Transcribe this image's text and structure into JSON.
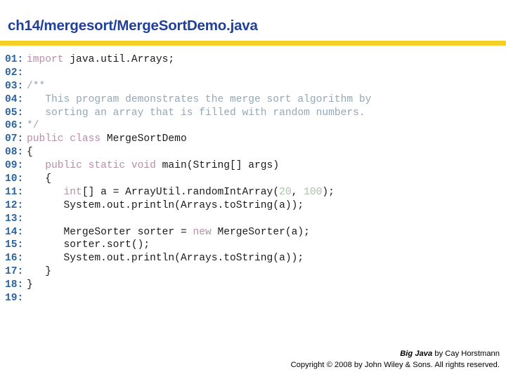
{
  "header": {
    "title": "ch14/mergesort/MergeSortDemo.java",
    "title_color": "#21409a",
    "rule_color": "#f6cf26"
  },
  "code": {
    "language": "java",
    "colors": {
      "lineno": "#2a64a0",
      "keyword": "#b98ca8",
      "comment": "#93a7b5",
      "number": "#a8c4a4",
      "plain": "#1a1a1a"
    },
    "lines": [
      {
        "n": "01:",
        "tokens": [
          {
            "t": "import",
            "c": "kw"
          },
          {
            "t": " java.util.Arrays;",
            "c": "pl"
          }
        ]
      },
      {
        "n": "02:",
        "tokens": []
      },
      {
        "n": "03:",
        "tokens": [
          {
            "t": "/**",
            "c": "cm"
          }
        ]
      },
      {
        "n": "04:",
        "tokens": [
          {
            "t": "   This program demonstrates the merge sort algorithm by",
            "c": "cm"
          }
        ]
      },
      {
        "n": "05:",
        "tokens": [
          {
            "t": "   sorting an array that is filled with random numbers.",
            "c": "cm"
          }
        ]
      },
      {
        "n": "06:",
        "tokens": [
          {
            "t": "*/",
            "c": "cm"
          }
        ]
      },
      {
        "n": "07:",
        "tokens": [
          {
            "t": "public class",
            "c": "kw"
          },
          {
            "t": " MergeSortDemo",
            "c": "pl"
          }
        ]
      },
      {
        "n": "08:",
        "tokens": [
          {
            "t": "{",
            "c": "pl"
          }
        ]
      },
      {
        "n": "09:",
        "tokens": [
          {
            "t": "   ",
            "c": "pl"
          },
          {
            "t": "public static void",
            "c": "kw"
          },
          {
            "t": " main(String[] args)",
            "c": "pl"
          }
        ]
      },
      {
        "n": "10:",
        "tokens": [
          {
            "t": "   {",
            "c": "pl"
          }
        ]
      },
      {
        "n": "11:",
        "tokens": [
          {
            "t": "      ",
            "c": "pl"
          },
          {
            "t": "int",
            "c": "kw"
          },
          {
            "t": "[] a = ArrayUtil.randomIntArray(",
            "c": "pl"
          },
          {
            "t": "20",
            "c": "num"
          },
          {
            "t": ", ",
            "c": "pl"
          },
          {
            "t": "100",
            "c": "num"
          },
          {
            "t": ");",
            "c": "pl"
          }
        ]
      },
      {
        "n": "12:",
        "tokens": [
          {
            "t": "      System.out.println(Arrays.toString(a));",
            "c": "pl"
          }
        ]
      },
      {
        "n": "13:",
        "tokens": []
      },
      {
        "n": "14:",
        "tokens": [
          {
            "t": "      MergeSorter sorter = ",
            "c": "pl"
          },
          {
            "t": "new",
            "c": "kw"
          },
          {
            "t": " MergeSorter(a);",
            "c": "pl"
          }
        ]
      },
      {
        "n": "15:",
        "tokens": [
          {
            "t": "      sorter.sort();",
            "c": "pl"
          }
        ]
      },
      {
        "n": "16:",
        "tokens": [
          {
            "t": "      System.out.println(Arrays.toString(a));",
            "c": "pl"
          }
        ]
      },
      {
        "n": "17:",
        "tokens": [
          {
            "t": "   }",
            "c": "pl"
          }
        ]
      },
      {
        "n": "18:",
        "tokens": [
          {
            "t": "}",
            "c": "pl"
          }
        ]
      },
      {
        "n": "19:",
        "tokens": []
      }
    ]
  },
  "footer": {
    "book_title": "Big Java",
    "credit_suffix": " by Cay Horstmann",
    "copyright": "Copyright © 2008 by John Wiley & Sons.  All rights reserved."
  }
}
